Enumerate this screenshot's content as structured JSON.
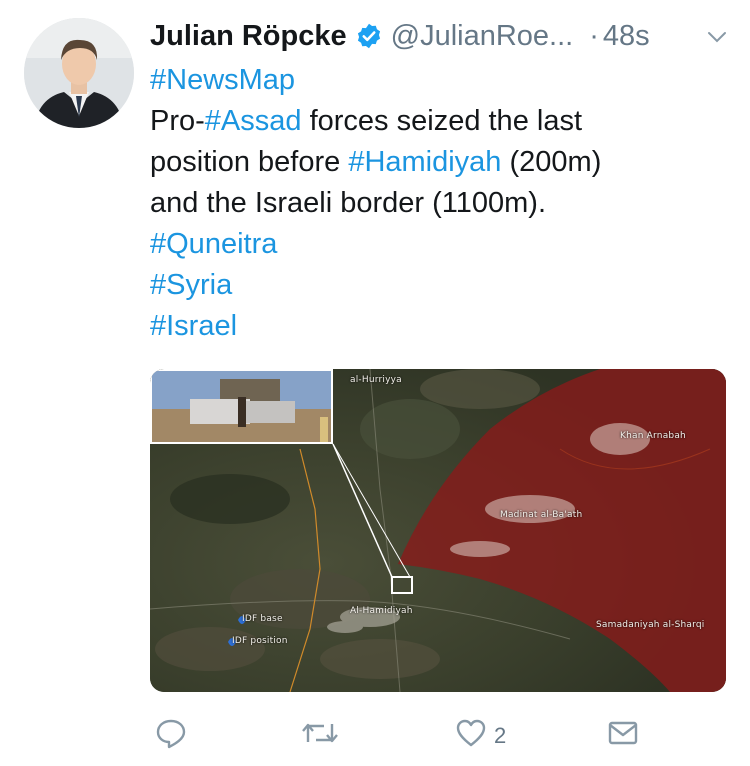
{
  "tweet": {
    "author_name": "Julian Röpcke",
    "handle": "@JulianRoe...",
    "separator": "·",
    "time": "48s",
    "text_lines": [
      [
        {
          "t": "#NewsMap",
          "tag": true
        }
      ],
      [
        {
          "t": "Pro-",
          "tag": false
        },
        {
          "t": "#Assad",
          "tag": true
        },
        {
          "t": " forces seized the last",
          "tag": false
        }
      ],
      [
        {
          "t": "position before ",
          "tag": false
        },
        {
          "t": "#Hamidiyah",
          "tag": true
        },
        {
          "t": " (200m)",
          "tag": false
        }
      ],
      [
        {
          "t": "and the Israeli border (1100m).",
          "tag": false
        }
      ],
      [
        {
          "t": "#Quneitra",
          "tag": true
        }
      ],
      [
        {
          "t": "#Syria",
          "tag": true
        }
      ],
      [
        {
          "t": "#Israel",
          "tag": true
        }
      ]
    ],
    "verified": true
  },
  "map": {
    "labels": {
      "hurriyya": "al-Hurriyya",
      "khan_arnabah": "Khan Arnabah",
      "madinat": "Madinat al-Ba'ath",
      "hamidiyah": "Al-Hamidiyah",
      "samadaniyah": "Samadaniyah al-Sharqi",
      "idf_base": "IDF base",
      "idf_position": "IDF position"
    }
  },
  "actions": {
    "reply_icon": "reply-icon",
    "retweet_icon": "retweet-icon",
    "like_icon": "heart-icon",
    "like_count": "2",
    "dm_icon": "envelope-icon"
  },
  "colors": {
    "link": "#1b95e0",
    "secondary": "#657786",
    "verified": "#1da1f2",
    "controlled_area": "#8b1a1a"
  }
}
